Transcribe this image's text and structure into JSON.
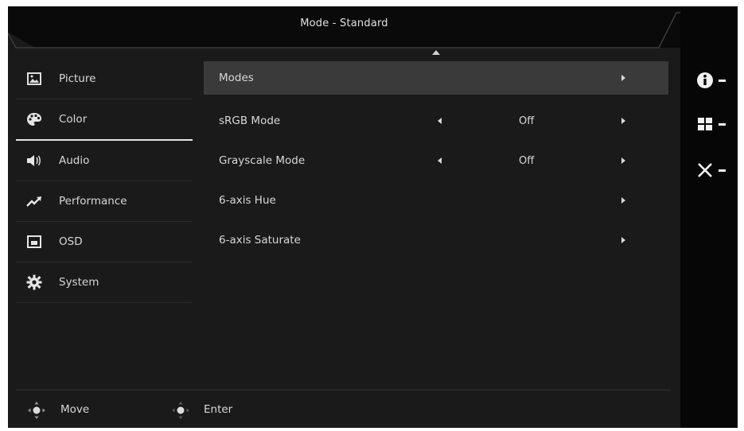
{
  "header": {
    "title": "Mode - Standard"
  },
  "sidebar": {
    "items": [
      {
        "label": "Picture",
        "icon": "picture-icon",
        "active": false
      },
      {
        "label": "Color",
        "icon": "palette-icon",
        "active": true
      },
      {
        "label": "Audio",
        "icon": "speaker-icon",
        "active": false
      },
      {
        "label": "Performance",
        "icon": "trend-up-icon",
        "active": false
      },
      {
        "label": "OSD",
        "icon": "osd-window-icon",
        "active": false
      },
      {
        "label": "System",
        "icon": "gear-icon",
        "active": false
      }
    ]
  },
  "main": {
    "rows": [
      {
        "label": "Modes",
        "value": "",
        "has_left_arrow": false,
        "has_right_arrow": true,
        "selected": true
      },
      {
        "label": "sRGB Mode",
        "value": "Off",
        "has_left_arrow": true,
        "has_right_arrow": true,
        "selected": false
      },
      {
        "label": "Grayscale Mode",
        "value": "Off",
        "has_left_arrow": true,
        "has_right_arrow": true,
        "selected": false
      },
      {
        "label": "6-axis Hue",
        "value": "",
        "has_left_arrow": false,
        "has_right_arrow": true,
        "selected": false
      },
      {
        "label": "6-axis Saturate",
        "value": "",
        "has_left_arrow": false,
        "has_right_arrow": true,
        "selected": false
      }
    ]
  },
  "footer": {
    "move_label": "Move",
    "enter_label": "Enter"
  },
  "hotkeys": [
    {
      "icon": "info-icon",
      "label": "-"
    },
    {
      "icon": "menu-grid-icon",
      "label": "-"
    },
    {
      "icon": "close-icon",
      "label": "-"
    }
  ],
  "colors": {
    "panel_bg": "#1a1a1a",
    "selected_row_bg": "#3a3a3a",
    "text": "#d8d8d8",
    "frame": "#060606"
  }
}
